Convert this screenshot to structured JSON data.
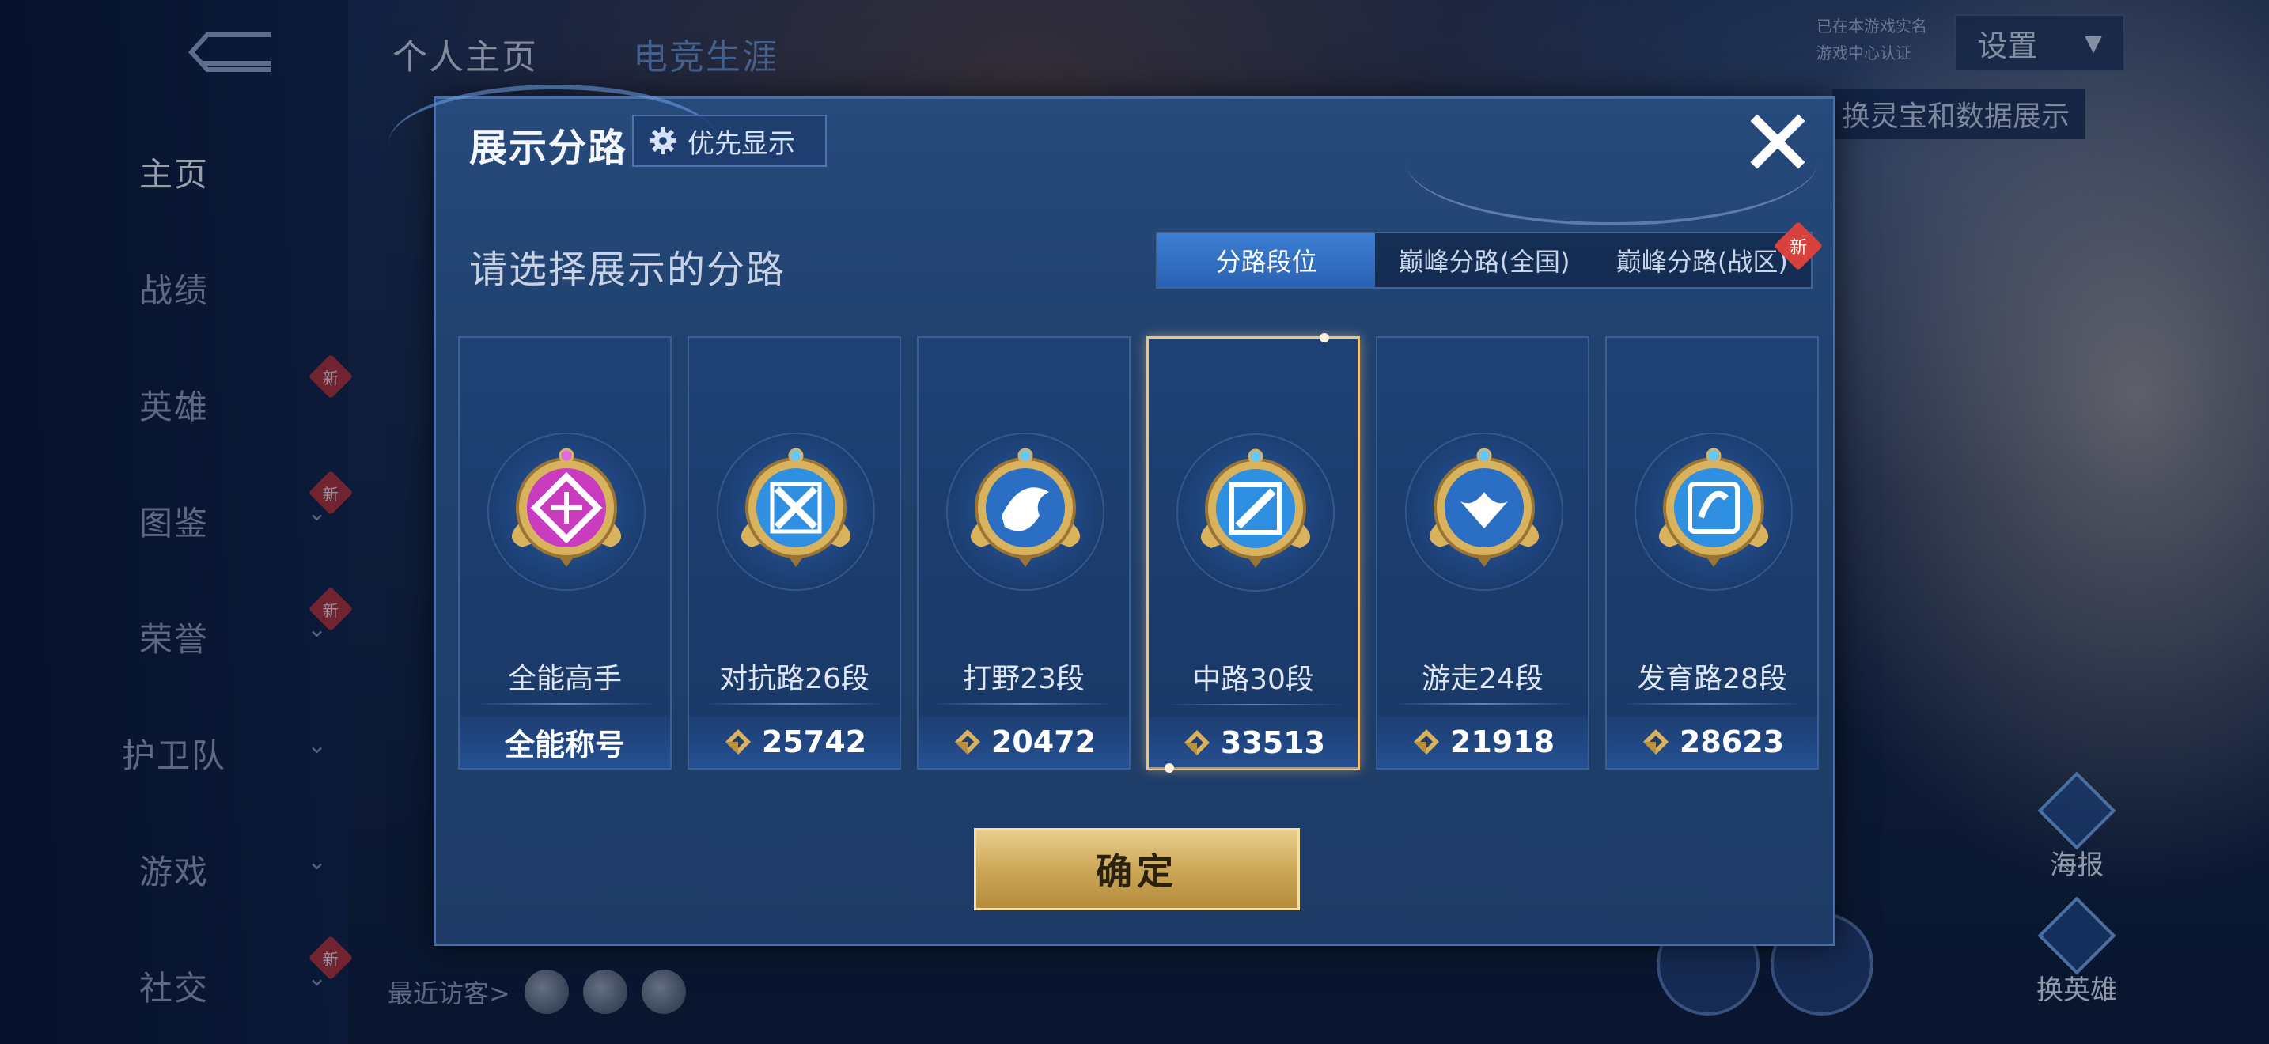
{
  "background": {
    "top_tabs": [
      "个人主页",
      "电竞生涯"
    ],
    "settings_label": "设置",
    "auth_note_lines": [
      "已在本游戏实名",
      "游戏中心认证"
    ],
    "swap_strip": "换灵宝和数据展示",
    "nav_items": [
      {
        "label": "主页",
        "active": true,
        "chevron": false,
        "new": false
      },
      {
        "label": "战绩",
        "active": false,
        "chevron": false,
        "new": false
      },
      {
        "label": "英雄",
        "active": false,
        "chevron": false,
        "new": true
      },
      {
        "label": "图鉴",
        "active": false,
        "chevron": true,
        "new": true
      },
      {
        "label": "荣誉",
        "active": false,
        "chevron": true,
        "new": true
      },
      {
        "label": "护卫队",
        "active": false,
        "chevron": true,
        "new": false
      },
      {
        "label": "游戏",
        "active": false,
        "chevron": true,
        "new": false
      },
      {
        "label": "社交",
        "active": false,
        "chevron": true,
        "new": true
      }
    ],
    "new_tag": "新",
    "recent_visitors": "最近访客>",
    "side_actions": [
      "海报",
      "换英雄"
    ]
  },
  "modal": {
    "title": "展示分路",
    "priority_label": "优先显示",
    "prompt": "请选择展示的分路",
    "tabs": [
      {
        "label": "分路段位",
        "active": true,
        "new": false
      },
      {
        "label": "巅峰分路(全国)",
        "active": false,
        "new": false
      },
      {
        "label": "巅峰分路(战区)",
        "active": false,
        "new": true
      }
    ],
    "cards": [
      {
        "name": "全能高手",
        "score": "全能称号",
        "show_icon": false,
        "selected": false,
        "badge_color": "#c93bbf",
        "icon": "allround-badge-icon"
      },
      {
        "name": "对抗路26段",
        "score": "25742",
        "show_icon": true,
        "selected": false,
        "badge_color": "#2f8fe0",
        "icon": "clash-lane-badge-icon"
      },
      {
        "name": "打野23段",
        "score": "20472",
        "show_icon": true,
        "selected": false,
        "badge_color": "#2a6fc4",
        "icon": "jungle-badge-icon"
      },
      {
        "name": "中路30段",
        "score": "33513",
        "show_icon": true,
        "selected": true,
        "badge_color": "#2f8fe0",
        "icon": "mid-lane-badge-icon"
      },
      {
        "name": "游走24段",
        "score": "21918",
        "show_icon": true,
        "selected": false,
        "badge_color": "#2a6fc4",
        "icon": "roam-badge-icon"
      },
      {
        "name": "发育路28段",
        "score": "28623",
        "show_icon": true,
        "selected": false,
        "badge_color": "#2f8fe0",
        "icon": "farm-lane-badge-icon"
      }
    ],
    "confirm_label": "确定"
  },
  "colors": {
    "accent_gold": "#f1c27d",
    "tab_active": "#2f6fc4",
    "new_badge": "#d9423c"
  }
}
